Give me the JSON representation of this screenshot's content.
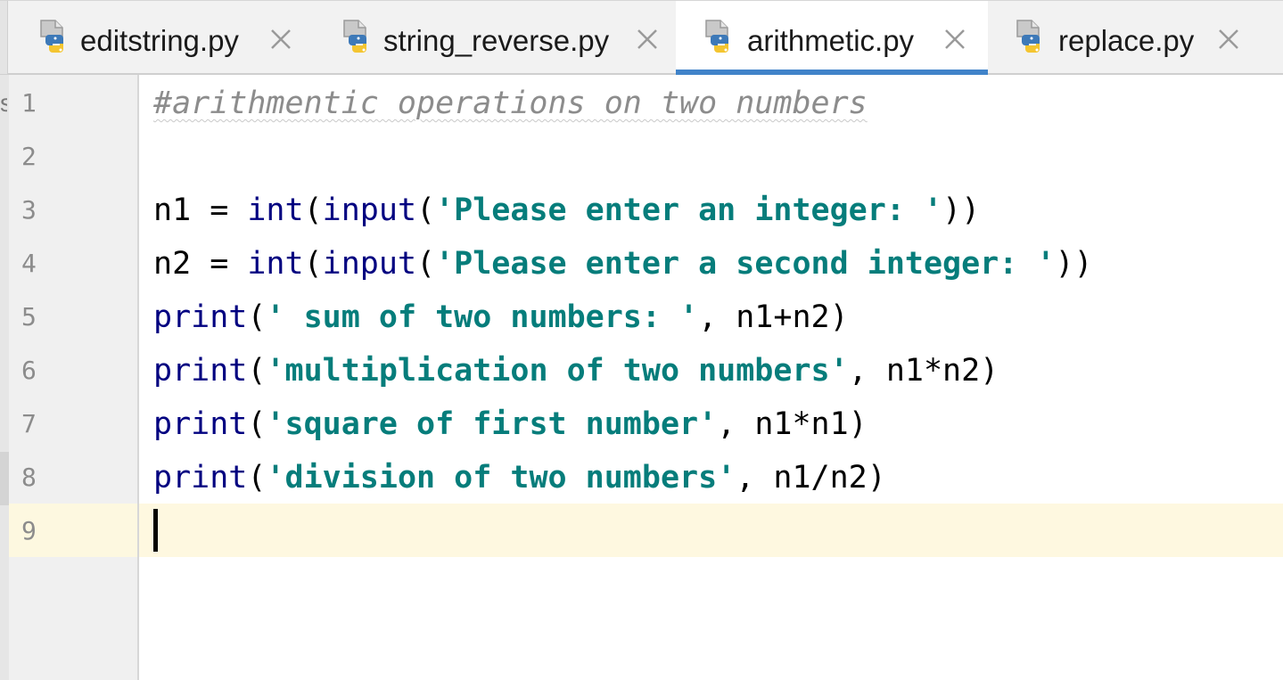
{
  "tabs": [
    {
      "label": "editstring.py",
      "icon": "python-file-icon",
      "active": false
    },
    {
      "label": "string_reverse.py",
      "icon": "python-file-icon",
      "active": false
    },
    {
      "label": "arithmetic.py",
      "icon": "python-file-icon",
      "active": true
    },
    {
      "label": "replace.py",
      "icon": "python-file-icon",
      "active": false
    }
  ],
  "close_glyph": "×",
  "gutter_cut_char": "s",
  "line_numbers": [
    "1",
    "2",
    "3",
    "4",
    "5",
    "6",
    "7",
    "8",
    "9"
  ],
  "code": {
    "l1": {
      "comment": "#arithmentic operations on two numbers"
    },
    "l3": {
      "a": "n1 = ",
      "b": "int",
      "c": "(",
      "d": "input",
      "e": "(",
      "f": "'Please enter an integer: '",
      "g": "))"
    },
    "l4": {
      "a": "n2 = ",
      "b": "int",
      "c": "(",
      "d": "input",
      "e": "(",
      "f": "'Please enter a second integer: '",
      "g": "))"
    },
    "l5": {
      "b": "print",
      "c": "(",
      "f": "' sum of two numbers: '",
      "g": ", n1+n2)"
    },
    "l6": {
      "b": "print",
      "c": "(",
      "f": "'multiplication of two numbers'",
      "g": ", n1*n2)"
    },
    "l7": {
      "b": "print",
      "c": "(",
      "f": "'square of first number'",
      "g": ", n1*n1)"
    },
    "l8": {
      "b": "print",
      "c": "(",
      "f": "'division of two numbers'",
      "g": ", n1/n2)"
    }
  },
  "colors": {
    "active_tab_underline": "#4083c9",
    "string": "#067d7b",
    "builtin": "#000080",
    "comment": "#8c8c8c",
    "current_line": "#fef8e0"
  }
}
